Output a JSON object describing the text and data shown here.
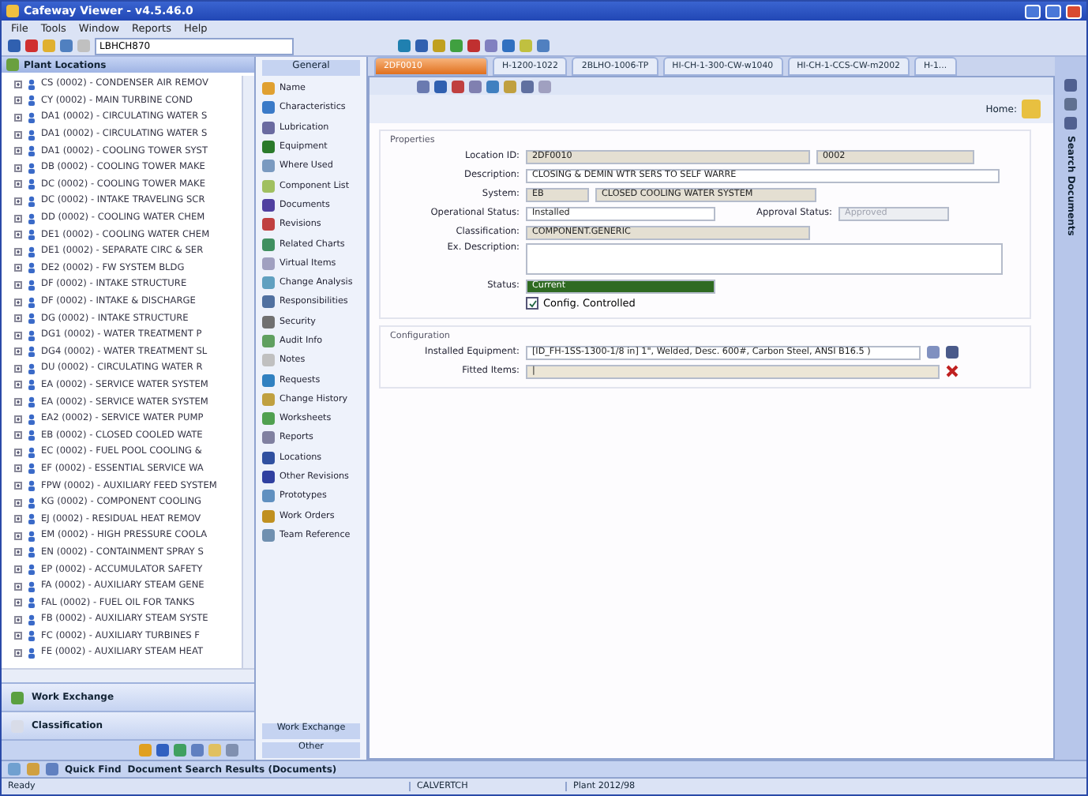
{
  "window": {
    "title": "Cafeway Viewer - v4.5.46.0"
  },
  "menu": [
    "File",
    "Tools",
    "Window",
    "Reports",
    "Help"
  ],
  "toolbar": {
    "search_value": "LBHCH870"
  },
  "tree": {
    "title": "Plant Locations",
    "items": [
      "CS (0002) - CONDENSER AIR REMOV",
      "CY (0002) - MAIN TURBINE COND",
      "DA1 (0002) - CIRCULATING WATER S",
      "DA1 (0002) - CIRCULATING WATER S",
      "DA1 (0002) - COOLING TOWER SYST",
      "DB (0002) - COOLING TOWER MAKE",
      "DC (0002) - COOLING TOWER MAKE",
      "DC (0002) - INTAKE TRAVELING SCR",
      "DD (0002) - COOLING WATER CHEM",
      "DE1 (0002) - COOLING WATER CHEM",
      "DE1 (0002) - SEPARATE CIRC & SER",
      "DE2 (0002) - FW SYSTEM BLDG",
      "DF (0002) - INTAKE STRUCTURE",
      "DF (0002) - INTAKE & DISCHARGE",
      "DG (0002) - INTAKE STRUCTURE",
      "DG1 (0002) - WATER TREATMENT P",
      "DG4 (0002) - WATER TREATMENT SL",
      "DU (0002) - CIRCULATING WATER R",
      "EA (0002) - SERVICE WATER SYSTEM",
      "EA (0002) - SERVICE WATER SYSTEM",
      "EA2 (0002) - SERVICE WATER PUMP",
      "EB (0002) - CLOSED COOLED WATE",
      "EC (0002) - FUEL POOL COOLING &",
      "EF (0002) - ESSENTIAL SERVICE WA",
      "FPW (0002) - AUXILIARY FEED SYSTEM",
      "KG (0002) - COMPONENT COOLING",
      "EJ (0002) - RESIDUAL HEAT REMOV",
      "EM (0002) - HIGH PRESSURE COOLA",
      "EN (0002) - CONTAINMENT SPRAY S",
      "EP (0002) - ACCUMULATOR SAFETY",
      "FA (0002) - AUXILIARY STEAM GENE",
      "FAL (0002) - FUEL OIL FOR TANKS",
      "FB (0002) - AUXILIARY STEAM SYSTE",
      "FC (0002) - AUXILIARY TURBINES F",
      "FE (0002) - AUXILIARY STEAM HEAT"
    ]
  },
  "left_sections": [
    "Work Exchange",
    "Classification"
  ],
  "nav": {
    "header": "General",
    "items": [
      "Name",
      "Characteristics",
      "Lubrication",
      "Equipment",
      "Where Used",
      "Component List",
      "Documents",
      "Revisions",
      "Related Charts",
      "Virtual Items",
      "Change Analysis",
      "Responsibilities",
      "Security",
      "Audit Info",
      "Notes",
      "Requests",
      "Change History",
      "Worksheets",
      "Reports",
      "Locations",
      "Other Revisions",
      "Prototypes",
      "Work Orders",
      "Team Reference"
    ],
    "footer": [
      "Work Exchange",
      "Other"
    ]
  },
  "tabs": [
    {
      "label": "2DF0010",
      "selected": true
    },
    {
      "label": "H-1200-1022",
      "selected": false
    },
    {
      "label": "2BLHO-1006-TP",
      "selected": false
    },
    {
      "label": "HI-CH-1-300-CW-w1040",
      "selected": false
    },
    {
      "label": "HI-CH-1-CCS-CW-m2002",
      "selected": false
    },
    {
      "label": "H-1...",
      "selected": false
    }
  ],
  "home_label": "Home:",
  "properties": {
    "title": "Properties",
    "location_id": {
      "label": "Location ID:",
      "value": "2DF0010",
      "unit": "0002"
    },
    "description": {
      "label": "Description:",
      "value": "CLOSING & DEMIN WTR SERS TO SELF WARRE"
    },
    "system": {
      "label": "System:",
      "code": "EB",
      "name": "CLOSED COOLING WATER SYSTEM"
    },
    "operational_status": {
      "label": "Operational Status:",
      "value": "Installed"
    },
    "approval_status": {
      "label": "Approval Status:",
      "value": "Approved",
      "disabled": true
    },
    "classification": {
      "label": "Classification:",
      "value": "COMPONENT.GENERIC"
    },
    "ex_description": {
      "label": "Ex. Description:"
    },
    "status": {
      "label": "Status:",
      "value": "Current"
    },
    "config_controlled": {
      "label": "Config. Controlled",
      "checked": true
    }
  },
  "configuration": {
    "title": "Configuration",
    "installed_equipment": {
      "label": "Installed Equipment:",
      "value": "[ID_FH-1SS-1300-1/8 in] 1\", Welded, Desc. 600#, Carbon Steel, ANSI B16.5 )"
    },
    "fitted_items": {
      "label": "Fitted Items:",
      "value": "|"
    }
  },
  "right_strip": "Search Documents",
  "bottom_bar": {
    "quick_find": "Quick Find",
    "results": "Document Search Results (Documents)"
  },
  "status_bar": {
    "state": "Ready",
    "user": "CALVERTCH",
    "plant": "Plant 2012/98"
  }
}
